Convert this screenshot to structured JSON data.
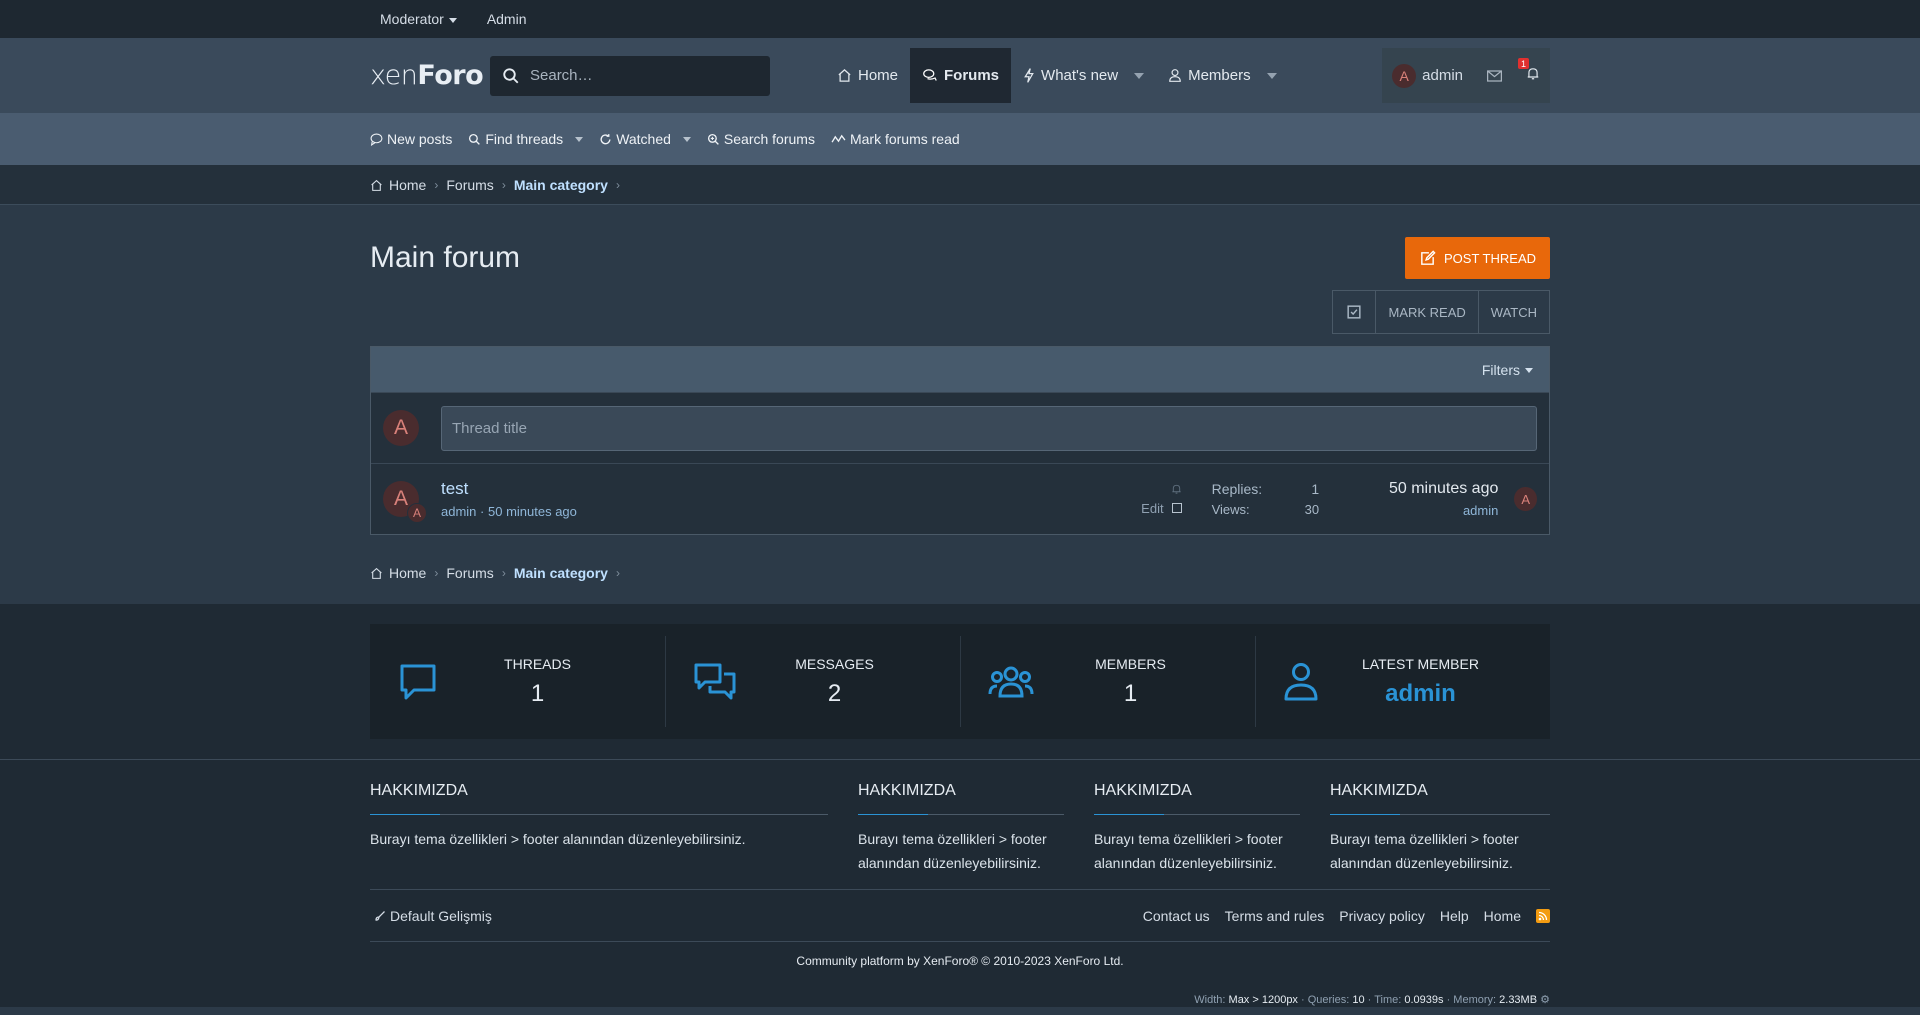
{
  "staffbar": {
    "moderator": "Moderator",
    "admin": "Admin"
  },
  "header": {
    "logo_light": "xen",
    "logo_bold": "Foro",
    "search_placeholder": "Search…",
    "nav": {
      "home": "Home",
      "forums": "Forums",
      "whats_new": "What's new",
      "members": "Members"
    },
    "user": {
      "avatar_letter": "A",
      "name": "admin"
    },
    "alerts_badge": "1"
  },
  "subnav": {
    "new_posts": "New posts",
    "find_threads": "Find threads",
    "watched": "Watched",
    "search_forums": "Search forums",
    "mark_read": "Mark forums read"
  },
  "breadcrumb": {
    "home": "Home",
    "forums": "Forums",
    "category": "Main category"
  },
  "main": {
    "title": "Main forum",
    "post_thread": "POST THREAD",
    "mark_read": "MARK READ",
    "watch": "WATCH",
    "filters": "Filters",
    "new_thread_avatar": "A",
    "thread_title_placeholder": "Thread title"
  },
  "threads": [
    {
      "avatar": "A",
      "mini_avatar": "A",
      "title": "test",
      "author": "admin",
      "time": "50 minutes ago",
      "edit": "Edit",
      "replies_label": "Replies:",
      "replies": "1",
      "views_label": "Views:",
      "views": "30",
      "latest_time": "50 minutes ago",
      "latest_user": "admin",
      "latest_avatar": "A"
    }
  ],
  "stats": [
    {
      "label": "THREADS",
      "value": "1",
      "icon": "comment-icon"
    },
    {
      "label": "MESSAGES",
      "value": "2",
      "icon": "comments-icon"
    },
    {
      "label": "MEMBERS",
      "value": "1",
      "icon": "users-icon"
    },
    {
      "label": "LATEST MEMBER",
      "value": "admin",
      "icon": "user-icon"
    }
  ],
  "footer": {
    "cols": [
      {
        "title": "HAKKIMIZDA",
        "text": "Burayı tema özellikleri > footer alanından düzenleyebilirsiniz."
      },
      {
        "title": "HAKKIMIZDA",
        "text": "Burayı tema özellikleri > footer alanından düzenleyebilirsiniz."
      },
      {
        "title": "HAKKIMIZDA",
        "text": "Burayı tema özellikleri > footer alanından düzenleyebilirsiniz."
      },
      {
        "title": "HAKKIMIZDA",
        "text": "Burayı tema özellikleri > footer alanından düzenleyebilirsiniz."
      }
    ],
    "style": "Default Gelişmiş",
    "links": {
      "contact": "Contact us",
      "terms": "Terms and rules",
      "privacy": "Privacy policy",
      "help": "Help",
      "home": "Home"
    },
    "copyright": "Community platform by XenForo® © 2010-2023 XenForo Ltd.",
    "debug": {
      "width_label": "Width:",
      "width": "Max > 1200px",
      "queries_label": "· Queries:",
      "queries": "10",
      "time_label": "· Time:",
      "time": "0.0939s",
      "memory_label": "· Memory:",
      "memory": "2.33MB"
    }
  },
  "colors": {
    "accent": "#e8680b",
    "link": "#bfe0ff",
    "stat_blue": "#2a93d5"
  }
}
